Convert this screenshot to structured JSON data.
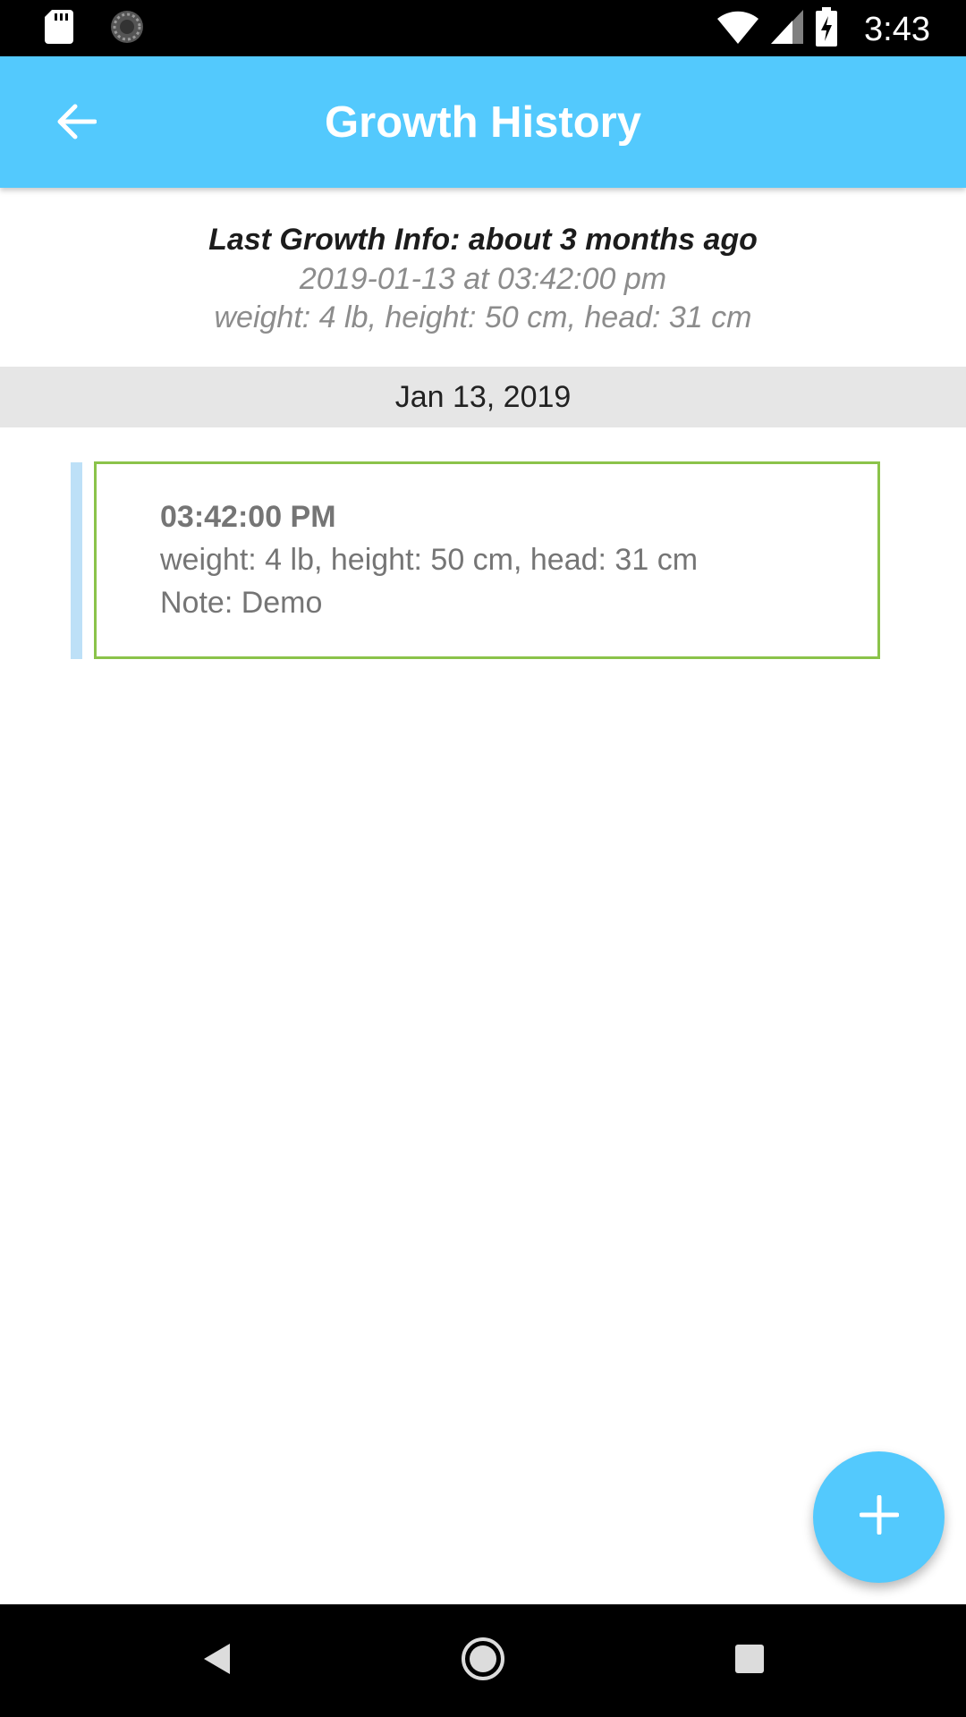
{
  "status_bar": {
    "time": "3:43",
    "icons": [
      "sd-card-icon",
      "sync-icon",
      "wifi-icon",
      "signal-icon",
      "battery-charging-icon"
    ]
  },
  "app_bar": {
    "title": "Growth History",
    "back_icon": "arrow-back-icon"
  },
  "summary": {
    "title": "Last Growth Info: about 3 months ago",
    "datetime": "2019-01-13 at 03:42:00 pm",
    "measurements": "weight: 4 lb, height: 50 cm, head: 31 cm"
  },
  "groups": [
    {
      "date": "Jan 13, 2019",
      "entries": [
        {
          "time": "03:42:00 PM",
          "measurements": "weight: 4 lb, height: 50 cm, head: 31 cm",
          "note": "Note: Demo"
        }
      ]
    }
  ],
  "fab": {
    "icon": "plus-icon"
  },
  "nav_bar": {
    "icons": [
      "back-triangle-icon",
      "home-circle-icon",
      "recents-square-icon"
    ]
  },
  "colors": {
    "primary": "#53c9fd",
    "entry_border": "#8bc34a",
    "entry_accent": "#bde0f7",
    "date_header_bg": "#e6e6e6"
  }
}
